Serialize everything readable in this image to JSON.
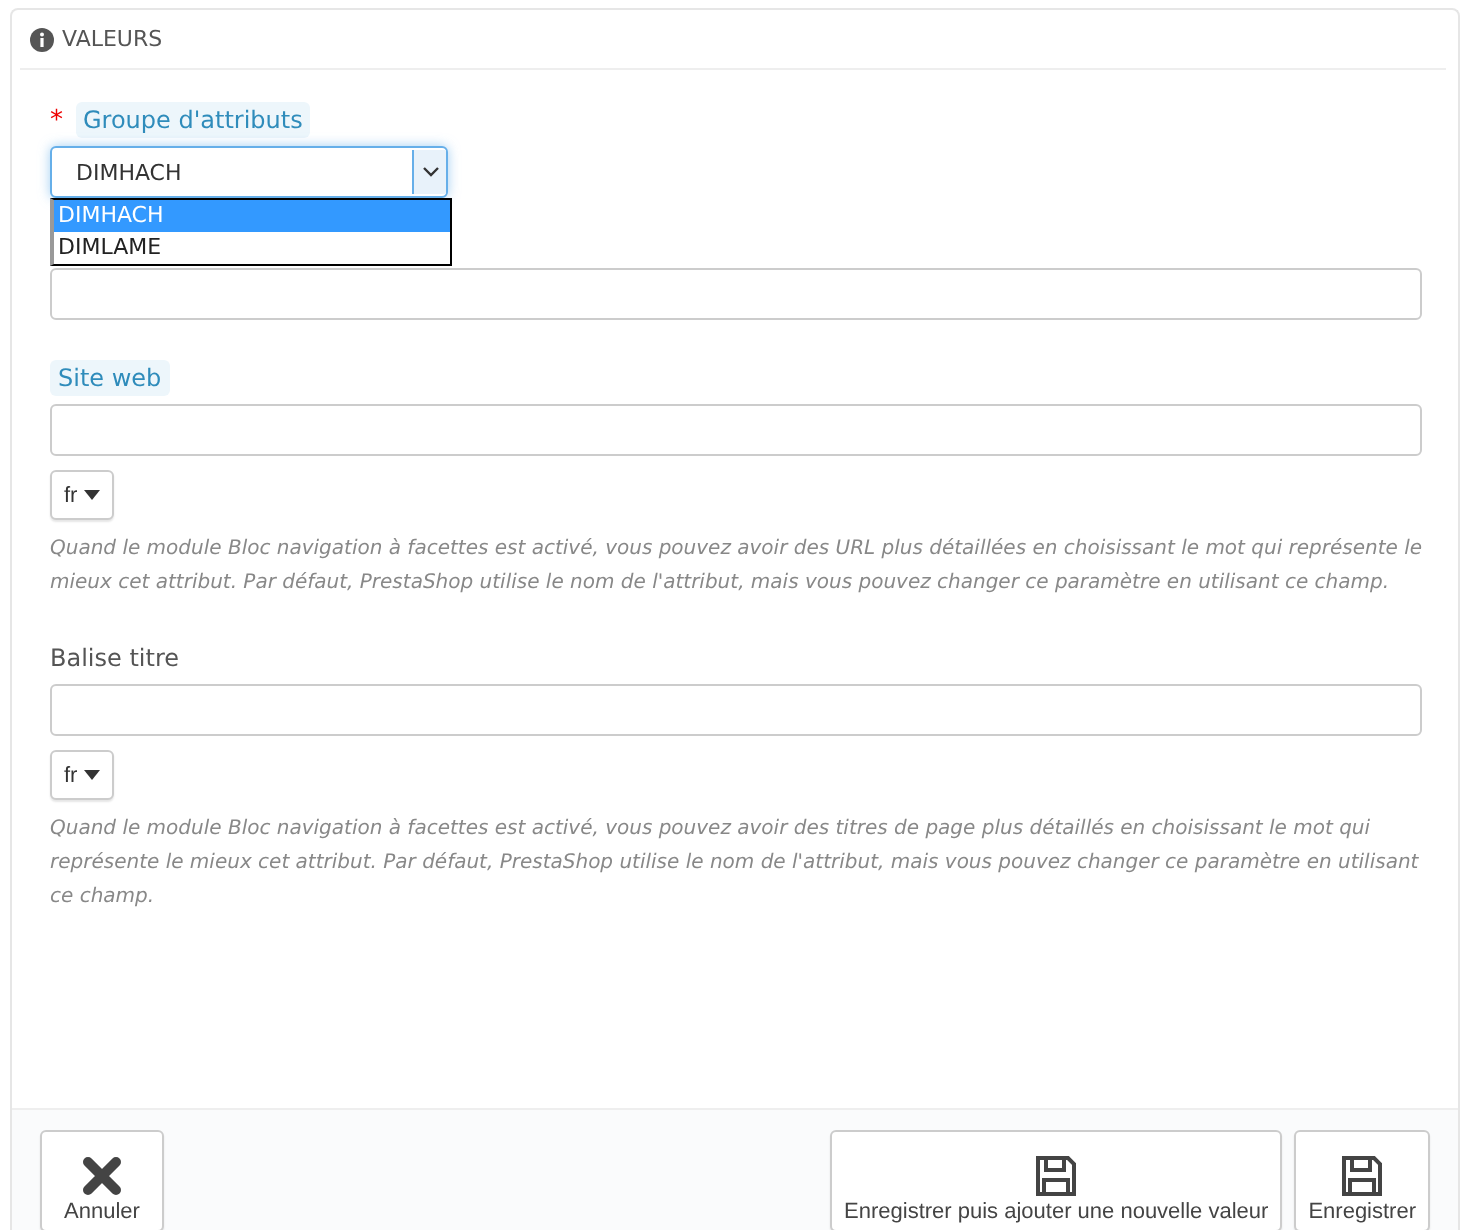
{
  "panel": {
    "title": "VALEURS"
  },
  "group_field": {
    "required_mark": "*",
    "label": "Groupe d'attributs",
    "value": "DIMHACH",
    "options": [
      {
        "label": "DIMHACH",
        "selected": true
      },
      {
        "label": "DIMLAME",
        "selected": false
      }
    ]
  },
  "fields": [
    {
      "kind": "plain"
    },
    {
      "kind": "lang",
      "label": "Site web",
      "highlighted": true,
      "lang": "fr",
      "help": "Quand le module Bloc navigation à facettes est activé, vous pouvez avoir des URL plus détaillées en choisissant le mot qui représente le mieux cet attribut. Par défaut, PrestaShop utilise le nom de l'attribut, mais vous pouvez changer ce paramètre en utilisant ce champ."
    },
    {
      "kind": "lang",
      "label": "Balise titre",
      "highlighted": false,
      "lang": "fr",
      "help": "Quand le module Bloc navigation à facettes est activé, vous pouvez avoir des titres de page plus détaillés en choisissant le mot qui représente le mieux cet attribut. Par défaut, PrestaShop utilise le nom de l'attribut, mais vous pouvez changer ce paramètre en utilisant ce champ."
    }
  ],
  "footer": {
    "buttons": [
      {
        "kind": "cancel",
        "label": "Annuler"
      },
      {
        "kind": "save",
        "label": "Enregistrer puis ajouter une nouvelle valeur"
      },
      {
        "kind": "save",
        "label": "Enregistrer"
      }
    ]
  }
}
